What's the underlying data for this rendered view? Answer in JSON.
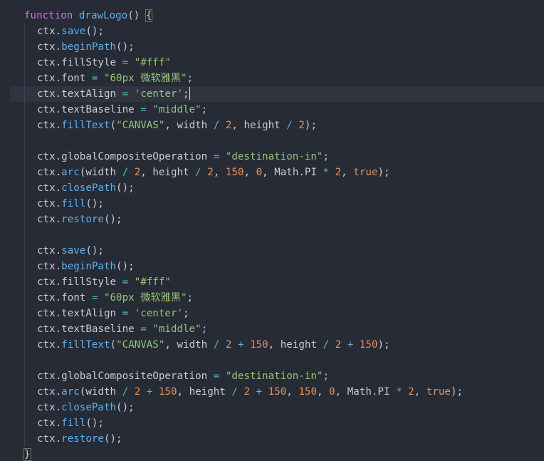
{
  "editor": {
    "lines": [
      {
        "indent": 0,
        "tokens": [
          {
            "t": "function ",
            "c": "keyword"
          },
          {
            "t": "drawLogo",
            "c": "fn-name"
          },
          {
            "t": "() ",
            "c": "punct"
          },
          {
            "t": "{",
            "c": "bracket-match"
          }
        ]
      },
      {
        "indent": 1,
        "tokens": [
          {
            "t": "ctx.",
            "c": "plain"
          },
          {
            "t": "save",
            "c": "method"
          },
          {
            "t": "();",
            "c": "punct"
          }
        ]
      },
      {
        "indent": 1,
        "tokens": [
          {
            "t": "ctx.",
            "c": "plain"
          },
          {
            "t": "beginPath",
            "c": "method"
          },
          {
            "t": "();",
            "c": "punct"
          }
        ]
      },
      {
        "indent": 1,
        "tokens": [
          {
            "t": "ctx.fillStyle ",
            "c": "plain"
          },
          {
            "t": "=",
            "c": "op"
          },
          {
            "t": " ",
            "c": "plain"
          },
          {
            "t": "\"#fff\"",
            "c": "string"
          }
        ]
      },
      {
        "indent": 1,
        "tokens": [
          {
            "t": "ctx.font ",
            "c": "plain"
          },
          {
            "t": "=",
            "c": "op"
          },
          {
            "t": " ",
            "c": "plain"
          },
          {
            "t": "\"60px 微软雅黑\"",
            "c": "string"
          },
          {
            "t": ";",
            "c": "punct"
          }
        ]
      },
      {
        "indent": 1,
        "current": true,
        "tokens": [
          {
            "t": "ctx.textAlign ",
            "c": "plain"
          },
          {
            "t": "=",
            "c": "op"
          },
          {
            "t": " ",
            "c": "plain"
          },
          {
            "t": "'center'",
            "c": "string"
          },
          {
            "t": ";",
            "c": "punct"
          }
        ]
      },
      {
        "indent": 1,
        "tokens": [
          {
            "t": "ctx.textBaseline ",
            "c": "plain"
          },
          {
            "t": "=",
            "c": "op"
          },
          {
            "t": " ",
            "c": "plain"
          },
          {
            "t": "\"middle\"",
            "c": "string"
          },
          {
            "t": ";",
            "c": "punct"
          }
        ]
      },
      {
        "indent": 1,
        "tokens": [
          {
            "t": "ctx.",
            "c": "plain"
          },
          {
            "t": "fillText",
            "c": "method"
          },
          {
            "t": "(",
            "c": "punct"
          },
          {
            "t": "\"CANVAS\"",
            "c": "string"
          },
          {
            "t": ", width ",
            "c": "plain"
          },
          {
            "t": "/",
            "c": "op"
          },
          {
            "t": " ",
            "c": "plain"
          },
          {
            "t": "2",
            "c": "number"
          },
          {
            "t": ", height ",
            "c": "plain"
          },
          {
            "t": "/",
            "c": "op"
          },
          {
            "t": " ",
            "c": "plain"
          },
          {
            "t": "2",
            "c": "number"
          },
          {
            "t": ");",
            "c": "punct"
          }
        ]
      },
      {
        "indent": 1,
        "blank": true,
        "tokens": []
      },
      {
        "indent": 1,
        "tokens": [
          {
            "t": "ctx.globalCompositeOperation ",
            "c": "plain"
          },
          {
            "t": "=",
            "c": "op"
          },
          {
            "t": " ",
            "c": "plain"
          },
          {
            "t": "\"destination-in\"",
            "c": "string"
          },
          {
            "t": ";",
            "c": "punct"
          }
        ]
      },
      {
        "indent": 1,
        "tokens": [
          {
            "t": "ctx.",
            "c": "plain"
          },
          {
            "t": "arc",
            "c": "method"
          },
          {
            "t": "(width ",
            "c": "plain"
          },
          {
            "t": "/",
            "c": "op"
          },
          {
            "t": " ",
            "c": "plain"
          },
          {
            "t": "2",
            "c": "number"
          },
          {
            "t": ", height ",
            "c": "plain"
          },
          {
            "t": "/",
            "c": "op"
          },
          {
            "t": " ",
            "c": "plain"
          },
          {
            "t": "2",
            "c": "number"
          },
          {
            "t": ", ",
            "c": "plain"
          },
          {
            "t": "150",
            "c": "number"
          },
          {
            "t": ", ",
            "c": "plain"
          },
          {
            "t": "0",
            "c": "number"
          },
          {
            "t": ", Math.PI ",
            "c": "plain"
          },
          {
            "t": "*",
            "c": "op"
          },
          {
            "t": " ",
            "c": "plain"
          },
          {
            "t": "2",
            "c": "number"
          },
          {
            "t": ", ",
            "c": "plain"
          },
          {
            "t": "true",
            "c": "bool"
          },
          {
            "t": ");",
            "c": "punct"
          }
        ]
      },
      {
        "indent": 1,
        "tokens": [
          {
            "t": "ctx.",
            "c": "plain"
          },
          {
            "t": "closePath",
            "c": "method"
          },
          {
            "t": "();",
            "c": "punct"
          }
        ]
      },
      {
        "indent": 1,
        "tokens": [
          {
            "t": "ctx.",
            "c": "plain"
          },
          {
            "t": "fill",
            "c": "method"
          },
          {
            "t": "();",
            "c": "punct"
          }
        ]
      },
      {
        "indent": 1,
        "tokens": [
          {
            "t": "ctx.",
            "c": "plain"
          },
          {
            "t": "restore",
            "c": "method"
          },
          {
            "t": "();",
            "c": "punct"
          }
        ]
      },
      {
        "indent": 1,
        "blank": true,
        "tokens": []
      },
      {
        "indent": 1,
        "tokens": [
          {
            "t": "ctx.",
            "c": "plain"
          },
          {
            "t": "save",
            "c": "method"
          },
          {
            "t": "();",
            "c": "punct"
          }
        ]
      },
      {
        "indent": 1,
        "tokens": [
          {
            "t": "ctx.",
            "c": "plain"
          },
          {
            "t": "beginPath",
            "c": "method"
          },
          {
            "t": "();",
            "c": "punct"
          }
        ]
      },
      {
        "indent": 1,
        "tokens": [
          {
            "t": "ctx.fillStyle ",
            "c": "plain"
          },
          {
            "t": "=",
            "c": "op"
          },
          {
            "t": " ",
            "c": "plain"
          },
          {
            "t": "\"#fff\"",
            "c": "string"
          }
        ]
      },
      {
        "indent": 1,
        "tokens": [
          {
            "t": "ctx.font ",
            "c": "plain"
          },
          {
            "t": "=",
            "c": "op"
          },
          {
            "t": " ",
            "c": "plain"
          },
          {
            "t": "\"60px 微软雅黑\"",
            "c": "string"
          },
          {
            "t": ";",
            "c": "punct"
          }
        ]
      },
      {
        "indent": 1,
        "tokens": [
          {
            "t": "ctx.textAlign ",
            "c": "plain"
          },
          {
            "t": "=",
            "c": "op"
          },
          {
            "t": " ",
            "c": "plain"
          },
          {
            "t": "'center'",
            "c": "string"
          },
          {
            "t": ";",
            "c": "punct"
          }
        ]
      },
      {
        "indent": 1,
        "tokens": [
          {
            "t": "ctx.textBaseline ",
            "c": "plain"
          },
          {
            "t": "=",
            "c": "op"
          },
          {
            "t": " ",
            "c": "plain"
          },
          {
            "t": "\"middle\"",
            "c": "string"
          },
          {
            "t": ";",
            "c": "punct"
          }
        ]
      },
      {
        "indent": 1,
        "tokens": [
          {
            "t": "ctx.",
            "c": "plain"
          },
          {
            "t": "fillText",
            "c": "method"
          },
          {
            "t": "(",
            "c": "punct"
          },
          {
            "t": "\"CANVAS\"",
            "c": "string"
          },
          {
            "t": ", width ",
            "c": "plain"
          },
          {
            "t": "/",
            "c": "op"
          },
          {
            "t": " ",
            "c": "plain"
          },
          {
            "t": "2",
            "c": "number"
          },
          {
            "t": " ",
            "c": "plain"
          },
          {
            "t": "+",
            "c": "op"
          },
          {
            "t": " ",
            "c": "plain"
          },
          {
            "t": "150",
            "c": "number"
          },
          {
            "t": ", height ",
            "c": "plain"
          },
          {
            "t": "/",
            "c": "op"
          },
          {
            "t": " ",
            "c": "plain"
          },
          {
            "t": "2",
            "c": "number"
          },
          {
            "t": " ",
            "c": "plain"
          },
          {
            "t": "+",
            "c": "op"
          },
          {
            "t": " ",
            "c": "plain"
          },
          {
            "t": "150",
            "c": "number"
          },
          {
            "t": ");",
            "c": "punct"
          }
        ]
      },
      {
        "indent": 1,
        "blank": true,
        "tokens": []
      },
      {
        "indent": 1,
        "tokens": [
          {
            "t": "ctx.globalCompositeOperation ",
            "c": "plain"
          },
          {
            "t": "=",
            "c": "op"
          },
          {
            "t": " ",
            "c": "plain"
          },
          {
            "t": "\"destination-in\"",
            "c": "string"
          },
          {
            "t": ";",
            "c": "punct"
          }
        ]
      },
      {
        "indent": 1,
        "tokens": [
          {
            "t": "ctx.",
            "c": "plain"
          },
          {
            "t": "arc",
            "c": "method"
          },
          {
            "t": "(width ",
            "c": "plain"
          },
          {
            "t": "/",
            "c": "op"
          },
          {
            "t": " ",
            "c": "plain"
          },
          {
            "t": "2",
            "c": "number"
          },
          {
            "t": " ",
            "c": "plain"
          },
          {
            "t": "+",
            "c": "op"
          },
          {
            "t": " ",
            "c": "plain"
          },
          {
            "t": "150",
            "c": "number"
          },
          {
            "t": ", height ",
            "c": "plain"
          },
          {
            "t": "/",
            "c": "op"
          },
          {
            "t": " ",
            "c": "plain"
          },
          {
            "t": "2",
            "c": "number"
          },
          {
            "t": " ",
            "c": "plain"
          },
          {
            "t": "+",
            "c": "op"
          },
          {
            "t": " ",
            "c": "plain"
          },
          {
            "t": "150",
            "c": "number"
          },
          {
            "t": ", ",
            "c": "plain"
          },
          {
            "t": "150",
            "c": "number"
          },
          {
            "t": ", ",
            "c": "plain"
          },
          {
            "t": "0",
            "c": "number"
          },
          {
            "t": ", Math.PI ",
            "c": "plain"
          },
          {
            "t": "*",
            "c": "op"
          },
          {
            "t": " ",
            "c": "plain"
          },
          {
            "t": "2",
            "c": "number"
          },
          {
            "t": ", ",
            "c": "plain"
          },
          {
            "t": "true",
            "c": "bool"
          },
          {
            "t": ");",
            "c": "punct"
          }
        ]
      },
      {
        "indent": 1,
        "tokens": [
          {
            "t": "ctx.",
            "c": "plain"
          },
          {
            "t": "closePath",
            "c": "method"
          },
          {
            "t": "();",
            "c": "punct"
          }
        ]
      },
      {
        "indent": 1,
        "tokens": [
          {
            "t": "ctx.",
            "c": "plain"
          },
          {
            "t": "fill",
            "c": "method"
          },
          {
            "t": "();",
            "c": "punct"
          }
        ]
      },
      {
        "indent": 1,
        "tokens": [
          {
            "t": "ctx.",
            "c": "plain"
          },
          {
            "t": "restore",
            "c": "method"
          },
          {
            "t": "();",
            "c": "punct"
          }
        ]
      },
      {
        "indent": 0,
        "tokens": [
          {
            "t": "}",
            "c": "bracket-match"
          }
        ]
      }
    ]
  },
  "colors": {
    "background": "#262b35",
    "current_line": "#2f3440",
    "keyword": "#c678dd",
    "function": "#61afef",
    "string": "#98c379",
    "number": "#e5925b",
    "operator": "#56b6c2"
  }
}
